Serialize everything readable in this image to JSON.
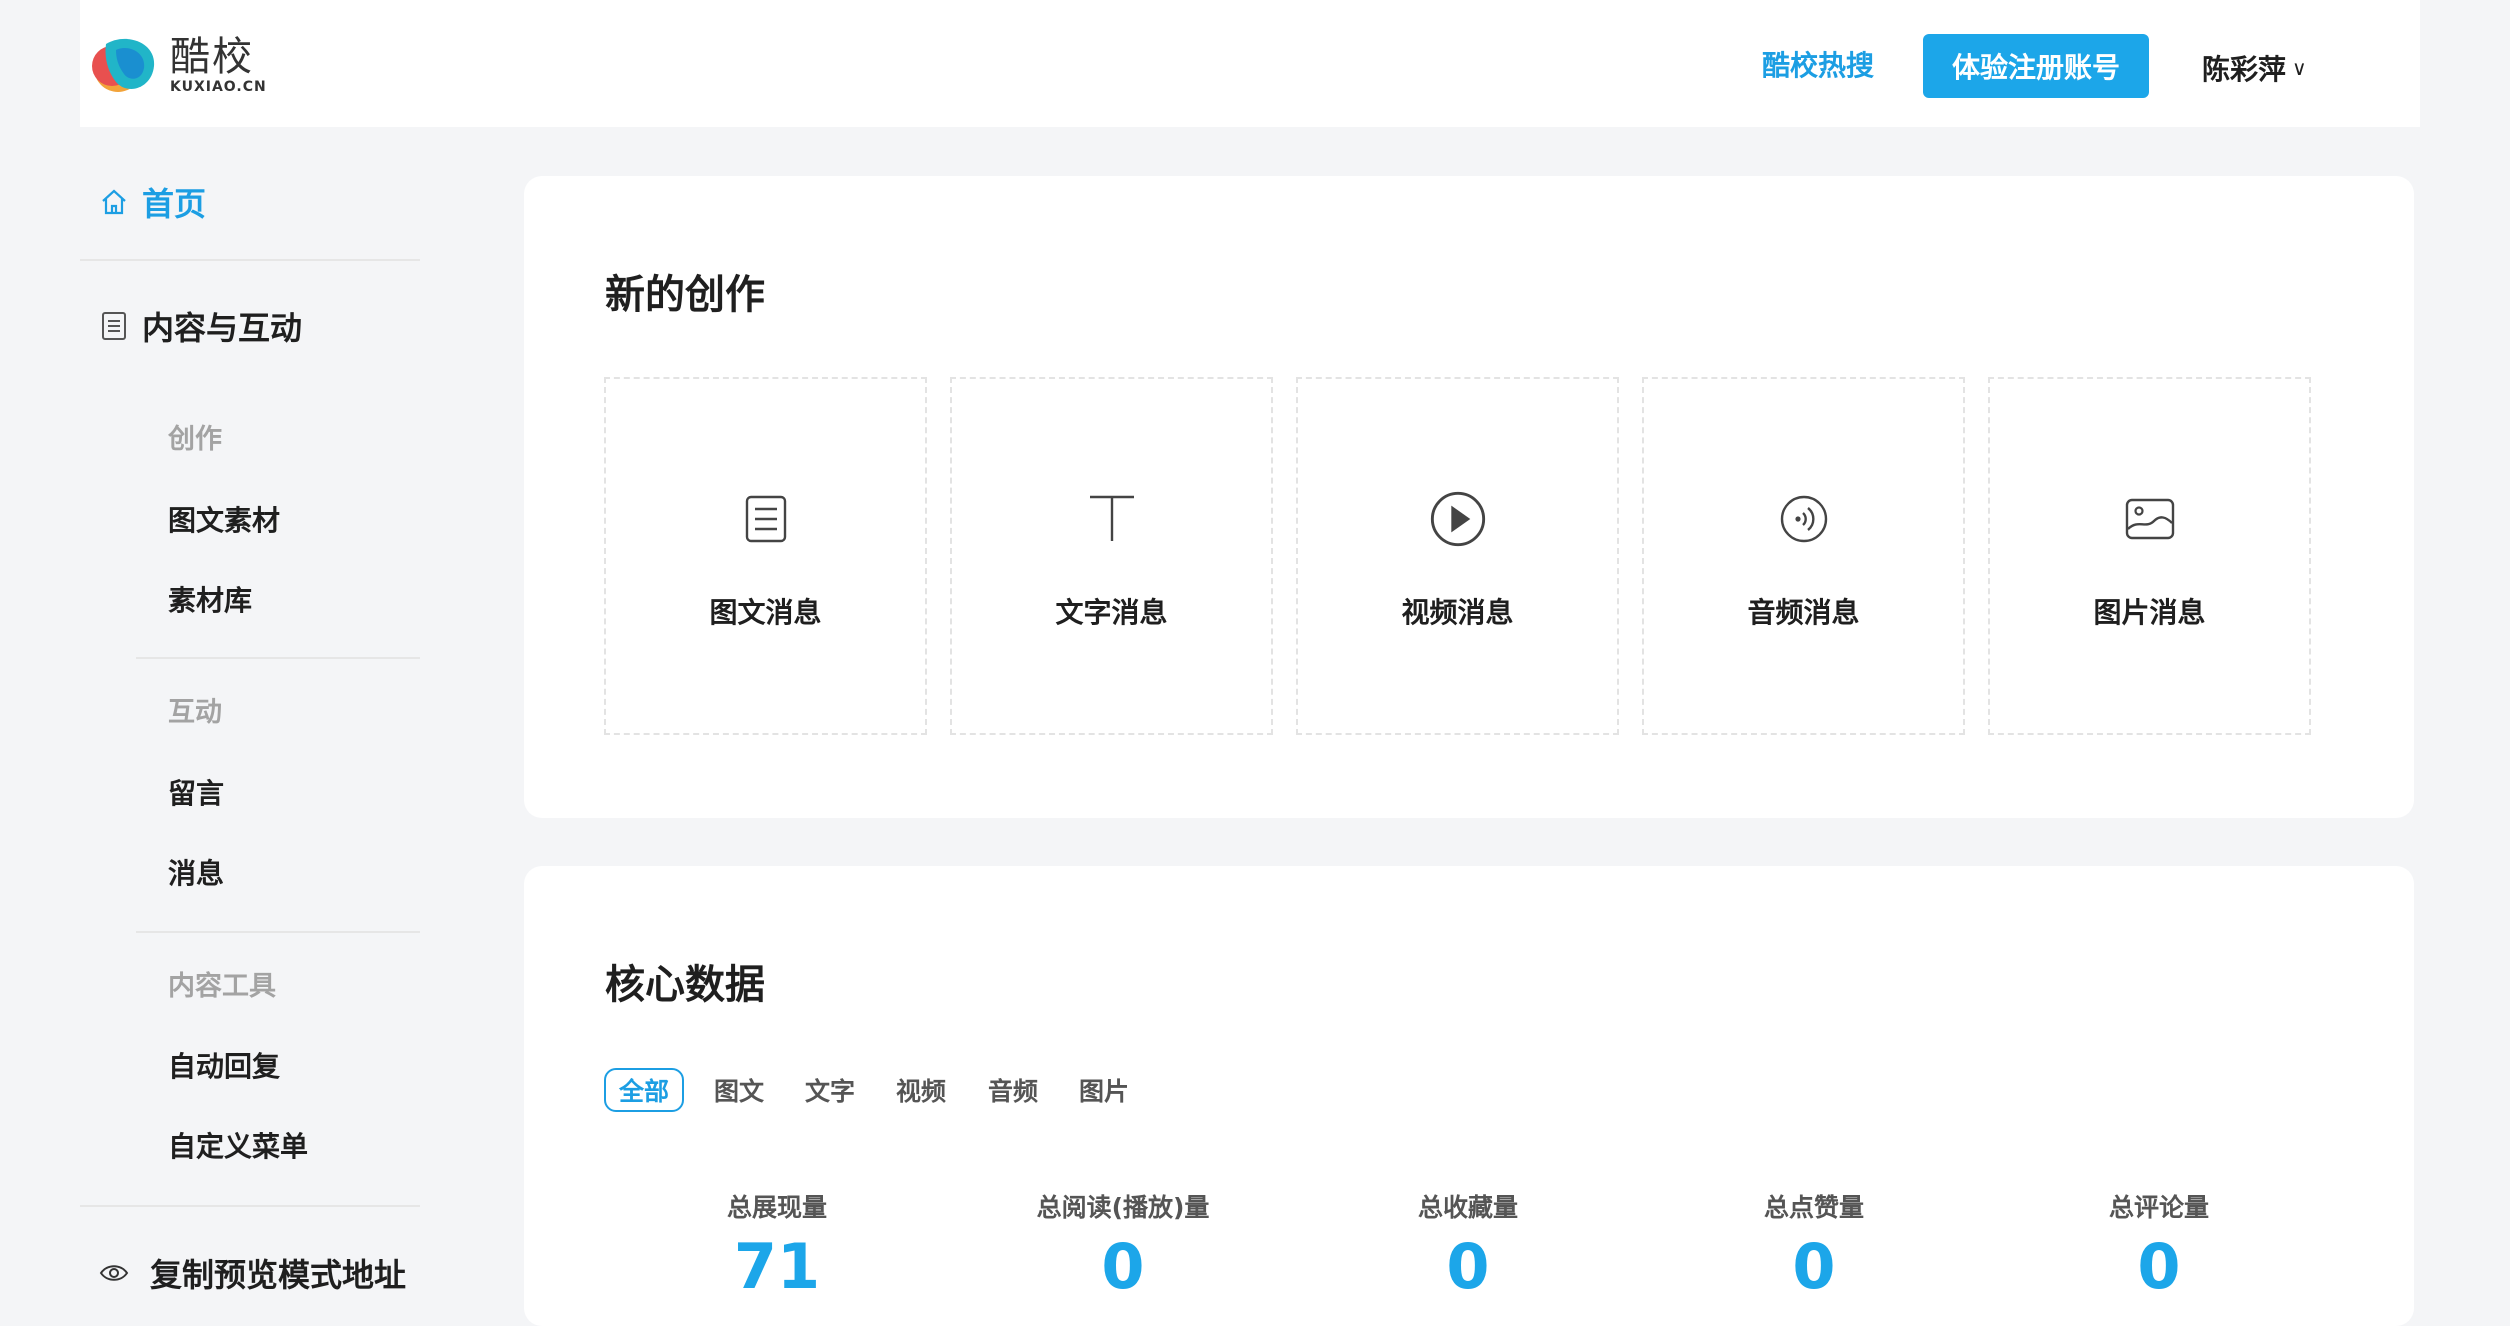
{
  "header": {
    "logo_cn": "酷校",
    "logo_en": "KUXIAO.CN",
    "hot_search": "酷校热搜",
    "trial_button": "体验注册账号",
    "user_name": "陈彩萍",
    "user_chevron": "∨"
  },
  "sidebar": {
    "home": "首页",
    "section": "内容与互动",
    "groups": [
      {
        "title": "创作",
        "items": [
          "图文素材",
          "素材库"
        ]
      },
      {
        "title": "互动",
        "items": [
          "留言",
          "消息"
        ]
      },
      {
        "title": "内容工具",
        "items": [
          "自动回复",
          "自定义菜单"
        ]
      }
    ],
    "preview": "复制预览模式地址"
  },
  "create": {
    "title": "新的创作",
    "tiles": [
      {
        "label": "图文消息",
        "icon": "article-icon"
      },
      {
        "label": "文字消息",
        "icon": "text-icon"
      },
      {
        "label": "视频消息",
        "icon": "video-play-icon"
      },
      {
        "label": "音频消息",
        "icon": "audio-icon"
      },
      {
        "label": "图片消息",
        "icon": "image-icon"
      }
    ]
  },
  "core": {
    "title": "核心数据",
    "tabs": [
      "全部",
      "图文",
      "文字",
      "视频",
      "音频",
      "图片"
    ],
    "active_tab": "全部",
    "stats": [
      {
        "label": "总展现量",
        "value": "71"
      },
      {
        "label": "总阅读(播放)量",
        "value": "0"
      },
      {
        "label": "总收藏量",
        "value": "0"
      },
      {
        "label": "总点赞量",
        "value": "0"
      },
      {
        "label": "总评论量",
        "value": "0"
      }
    ]
  },
  "colors": {
    "accent": "#1c9ee3",
    "button": "#1ca6e9",
    "background": "#f4f5f7"
  }
}
